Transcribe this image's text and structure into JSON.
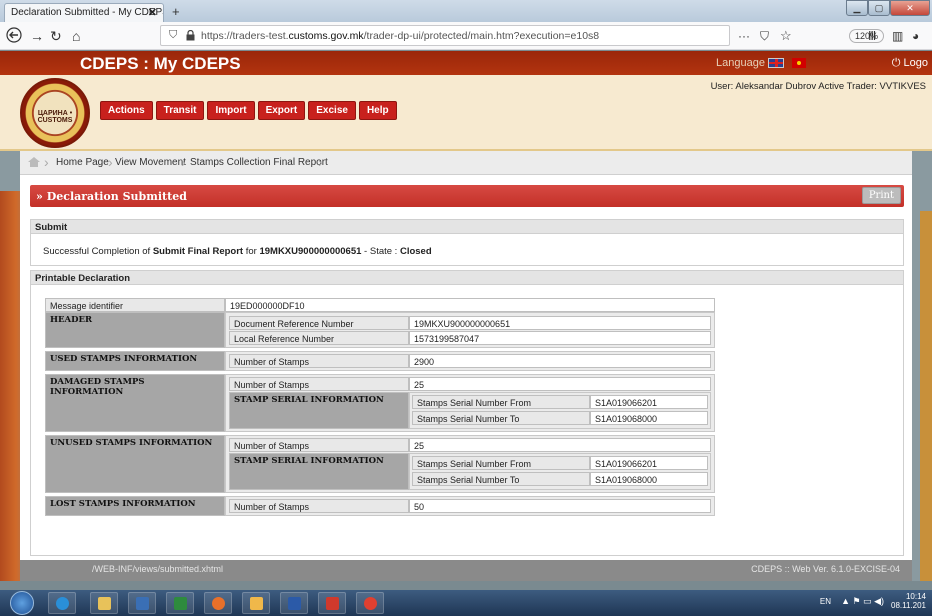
{
  "browser": {
    "tab_title": "Declaration Submitted - My CDEPS",
    "tab_close": "✕",
    "new_tab": "+",
    "url_prefix": "https://traders-test.",
    "url_domain": "customs.gov.mk",
    "url_suffix": "/trader-dp-ui/protected/main.htm?execution=e10s8",
    "zoom": "120%",
    "more": "···"
  },
  "app": {
    "title": "CDEPS : My CDEPS",
    "language_label": "Language",
    "logout_label": "Logo",
    "menu": [
      "Actions",
      "Transit",
      "Import",
      "Export",
      "Excise",
      "Help"
    ],
    "user_info": "User: Aleksandar Dubrov  Active Trader: VVTIKVES",
    "logo_text": "ЦАРИНА • CUSTOMS"
  },
  "breadcrumb": [
    "Home Page",
    "View Movement",
    "Stamps Collection Final Report"
  ],
  "declaration": {
    "title": "» Declaration Submitted",
    "print_label": "Print"
  },
  "submit_panel": {
    "title": "Submit",
    "msg_prefix": "Successful Completion of ",
    "msg_action": "Submit Final Report",
    "msg_for": " for ",
    "msg_ref": "19MKXU900000000651",
    "msg_state_prefix": " - State : ",
    "msg_state": "Closed"
  },
  "printable": {
    "title": "Printable Declaration",
    "message_identifier_label": "Message identifier",
    "message_identifier_value": "19ED000000DF10",
    "header_label": "HEADER",
    "doc_ref_label": "Document Reference Number",
    "doc_ref_value": "19MKXU900000000651",
    "local_ref_label": "Local Reference Number",
    "local_ref_value": "1573199587047",
    "used_label": "USED STAMPS INFORMATION",
    "used_num_label": "Number of Stamps",
    "used_num_value": "2900",
    "damaged_label": "DAMAGED STAMPS INFORMATION",
    "damaged_num_label": "Number of Stamps",
    "damaged_num_value": "25",
    "damaged_serial_label": "STAMP SERIAL INFORMATION",
    "damaged_from_label": "Stamps Serial Number From",
    "damaged_from_value": "S1A019066201",
    "damaged_to_label": "Stamps Serial Number To",
    "damaged_to_value": "S1A019068000",
    "unused_label": "UNUSED STAMPS INFORMATION",
    "unused_num_label": "Number of Stamps",
    "unused_num_value": "25",
    "unused_serial_label": "STAMP SERIAL INFORMATION",
    "unused_from_label": "Stamps Serial Number From",
    "unused_from_value": "S1A019066201",
    "unused_to_label": "Stamps Serial Number To",
    "unused_to_value": "S1A019068000",
    "lost_label": "LOST STAMPS INFORMATION",
    "lost_num_label": "Number of Stamps",
    "lost_num_value": "50"
  },
  "status": {
    "path": "/WEB-INF/views/submitted.xhtml",
    "version": "CDEPS :: Web Ver. 6.1.0-EXCISE-04"
  },
  "taskbar": {
    "lang": "EN",
    "time": "10:14",
    "date": "08.11.201"
  }
}
